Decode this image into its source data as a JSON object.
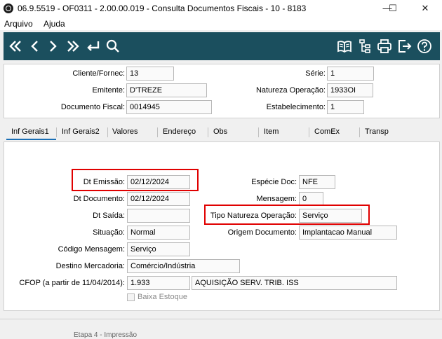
{
  "window": {
    "title": "06.9.5519 - OF0311 - 2.00.00.019 - Consulta Documentos Fiscais - 10 - 8183",
    "minimize": "—",
    "maximize": "☐",
    "close": "✕"
  },
  "menu": {
    "items": [
      "Arquivo",
      "Ajuda"
    ]
  },
  "toolbar": {
    "left_icons": [
      "first-icon",
      "previous-icon",
      "next-icon",
      "last-icon",
      "return-icon",
      "search-icon"
    ],
    "right_icons": [
      "book-icon",
      "tree-icon",
      "print-icon",
      "exit-icon",
      "help-icon"
    ],
    "color": "#1b4f5e"
  },
  "header": {
    "cliente_label": "Cliente/Fornec:",
    "cliente_value": "13",
    "emitente_label": "Emitente:",
    "emitente_value": "D'TREZE",
    "doc_fiscal_label": "Documento Fiscal:",
    "doc_fiscal_value": "0014945",
    "serie_label": "Série:",
    "serie_value": "1",
    "natureza_label": "Natureza Operação:",
    "natureza_value": "1933OI",
    "estab_label": "Estabelecimento:",
    "estab_value": "1"
  },
  "tabs": [
    "Inf Gerais1",
    "Inf Gerais2",
    "Valores",
    "Endereço",
    "Obs",
    "Item",
    "ComEx",
    "Transp"
  ],
  "active_tab": "Inf Gerais1",
  "form": {
    "dt_emissao_label": "Dt Emissão:",
    "dt_emissao_value": "02/12/2024",
    "dt_documento_label": "Dt Documento:",
    "dt_documento_value": "02/12/2024",
    "dt_saida_label": "Dt Saída:",
    "dt_saida_value": "",
    "situacao_label": "Situação:",
    "situacao_value": "Normal",
    "cod_msg_label": "Código Mensagem:",
    "cod_msg_value": "Serviço",
    "destino_label": "Destino Mercadoria:",
    "destino_value": "Comércio/Indústria",
    "cfop_label": "CFOP (a partir de 11/04/2014):",
    "cfop_value": "1.933",
    "cfop_desc": "AQUISIÇÃO SERV. TRIB. ISS",
    "especie_label": "Espécie Doc:",
    "especie_value": "NFE",
    "mensagem_label": "Mensagem:",
    "mensagem_value": "0",
    "tipo_nat_label": "Tipo Natureza Operação:",
    "tipo_nat_value": "Serviço",
    "origem_label": "Origem Documento:",
    "origem_value": "Implantacao Manual",
    "baixa_estoque_label": "Baixa Estoque",
    "baixa_estoque_checked": false
  },
  "highlight_color": "#e00000",
  "status": {
    "ghost_text": "Etapa 4 - Impressão"
  }
}
